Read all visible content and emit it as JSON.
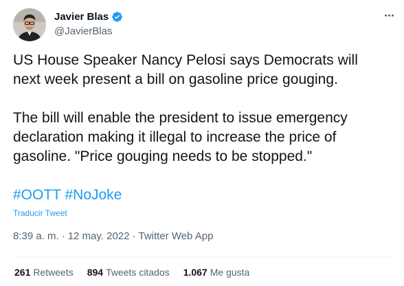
{
  "author": {
    "display_name": "Javier Blas",
    "handle": "@JavierBlas",
    "verified": true
  },
  "tweet": {
    "paragraph_1_line_1": "US House Speaker Nancy Pelosi says Democrats will",
    "paragraph_1_line_2": "next week present a bill on gasoline price gouging.",
    "paragraph_2_line_1": "The bill will enable the president to issue emergency",
    "paragraph_2_line_2": "declaration making it illegal to increase the price of",
    "paragraph_2_line_3": "gasoline. \"Price gouging needs to be stopped.\"",
    "hashtags": [
      "#OOTT",
      "#NoJoke"
    ],
    "translate_label": "Traducir Tweet"
  },
  "meta": {
    "time": "8:39 a. m.",
    "separator": "·",
    "date": "12 may. 2022",
    "source": "Twitter Web App"
  },
  "stats": {
    "retweets_count": "261",
    "retweets_label": "Retweets",
    "quotes_count": "894",
    "quotes_label": "Tweets citados",
    "likes_count": "1.067",
    "likes_label": "Me gusta"
  },
  "colors": {
    "link": "#1d9bf0",
    "text": "#0f1419",
    "secondary": "#536471",
    "divider": "#eff3f4"
  },
  "icons": {
    "verified": "verified-badge-icon",
    "more": "more-options-icon"
  }
}
